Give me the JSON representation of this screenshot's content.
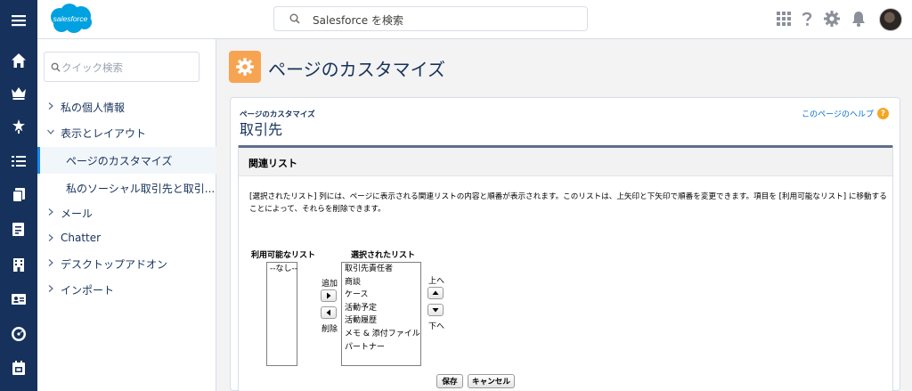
{
  "header": {
    "logo_text": "salesforce",
    "search_placeholder": "Salesforce を検索"
  },
  "icons": {
    "rail": [
      "menu-icon",
      "home-icon",
      "crown-icon",
      "star-icon",
      "checklist-icon",
      "copy-icon",
      "report-icon",
      "building-icon",
      "contact-card-icon",
      "gauge-icon",
      "calendar-icon"
    ],
    "header": [
      "app-launcher-icon",
      "help-icon",
      "gear-icon",
      "bell-icon"
    ]
  },
  "sidebar": {
    "quick_find_placeholder": "クイック検索",
    "items": [
      {
        "label": "私の個人情報",
        "expanded": false
      },
      {
        "label": "表示とレイアウト",
        "expanded": true
      },
      {
        "label": "ページのカスタマイズ",
        "active": true
      },
      {
        "label": "私のソーシャル取引先と取引..."
      },
      {
        "label": "メール",
        "expanded": false
      },
      {
        "label": "Chatter",
        "expanded": false
      },
      {
        "label": "デスクトップアドオン",
        "expanded": false
      },
      {
        "label": "インポート",
        "expanded": false
      }
    ]
  },
  "page": {
    "title": "ページのカスタマイズ",
    "eyebrow": "ページのカスタマイズ",
    "object_name": "取引先",
    "help_link": "このページのヘルプ",
    "help_glyph": "?"
  },
  "panel": {
    "title": "関連リスト",
    "description": "[選択されたリスト] 列には、ページに表示される関連リストの内容と順番が表示されます。このリストは、上矢印と下矢印で順番を変更できます。項目を [利用可能なリスト] に移動することによって、それらを削除できます。",
    "available_label": "利用可能なリスト",
    "available_items": [
      "--なし--"
    ],
    "selected_label": "選択されたリスト",
    "selected_items": [
      "取引先責任者",
      "商談",
      "ケース",
      "活動予定",
      "活動履歴",
      "メモ & 添付ファイル",
      "パートナー"
    ],
    "add_label": "追加",
    "remove_label": "削除",
    "up_label": "上へ",
    "down_label": "下へ",
    "save_label": "保存",
    "cancel_label": "キャンセル"
  },
  "colors": {
    "rail": "#16325c",
    "accent": "#1589ee",
    "badge": "#f7a452",
    "logo": "#00a1e0",
    "link": "#0070d2"
  }
}
